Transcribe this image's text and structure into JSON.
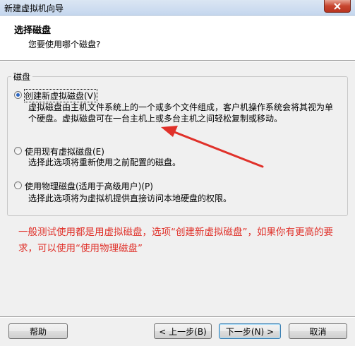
{
  "window": {
    "title": "新建虚拟机向导"
  },
  "header": {
    "title": "选择磁盘",
    "subtitle": "您要使用哪个磁盘?"
  },
  "group": {
    "label": "磁盘"
  },
  "options": [
    {
      "label": "创建新虚拟磁盘(V)",
      "checked": true,
      "description": [
        "虚拟磁盘由主机文件系统上的一个或多个文件组成，客户机操作系统会将其视为单",
        "个硬盘。虚拟磁盘可在一台主机上或多台主机之间轻松复制或移动。"
      ]
    },
    {
      "label": "使用现有虚拟磁盘(E)",
      "checked": false,
      "description": [
        "选择此选项将重新使用之前配置的磁盘。"
      ]
    },
    {
      "label": "使用物理磁盘(适用于高级用户)(P)",
      "checked": false,
      "description": [
        "选择此选项将为虚拟机提供直接访问本地硬盘的权限。"
      ]
    }
  ],
  "annotation": {
    "text": "一般测试使用都是用虚拟磁盘，选项“创建新虚拟磁盘”，如果你有更高的要求，可以使用“使用物理磁盘”",
    "color": "#e0312a"
  },
  "buttons": {
    "help": "帮助",
    "back": "< 上一步(B)",
    "next": "下一步(N) >",
    "cancel": "取消"
  },
  "colors": {
    "accent": "#2a66c4",
    "annotation": "#e0312a"
  },
  "icons": {
    "close": "close-icon"
  }
}
